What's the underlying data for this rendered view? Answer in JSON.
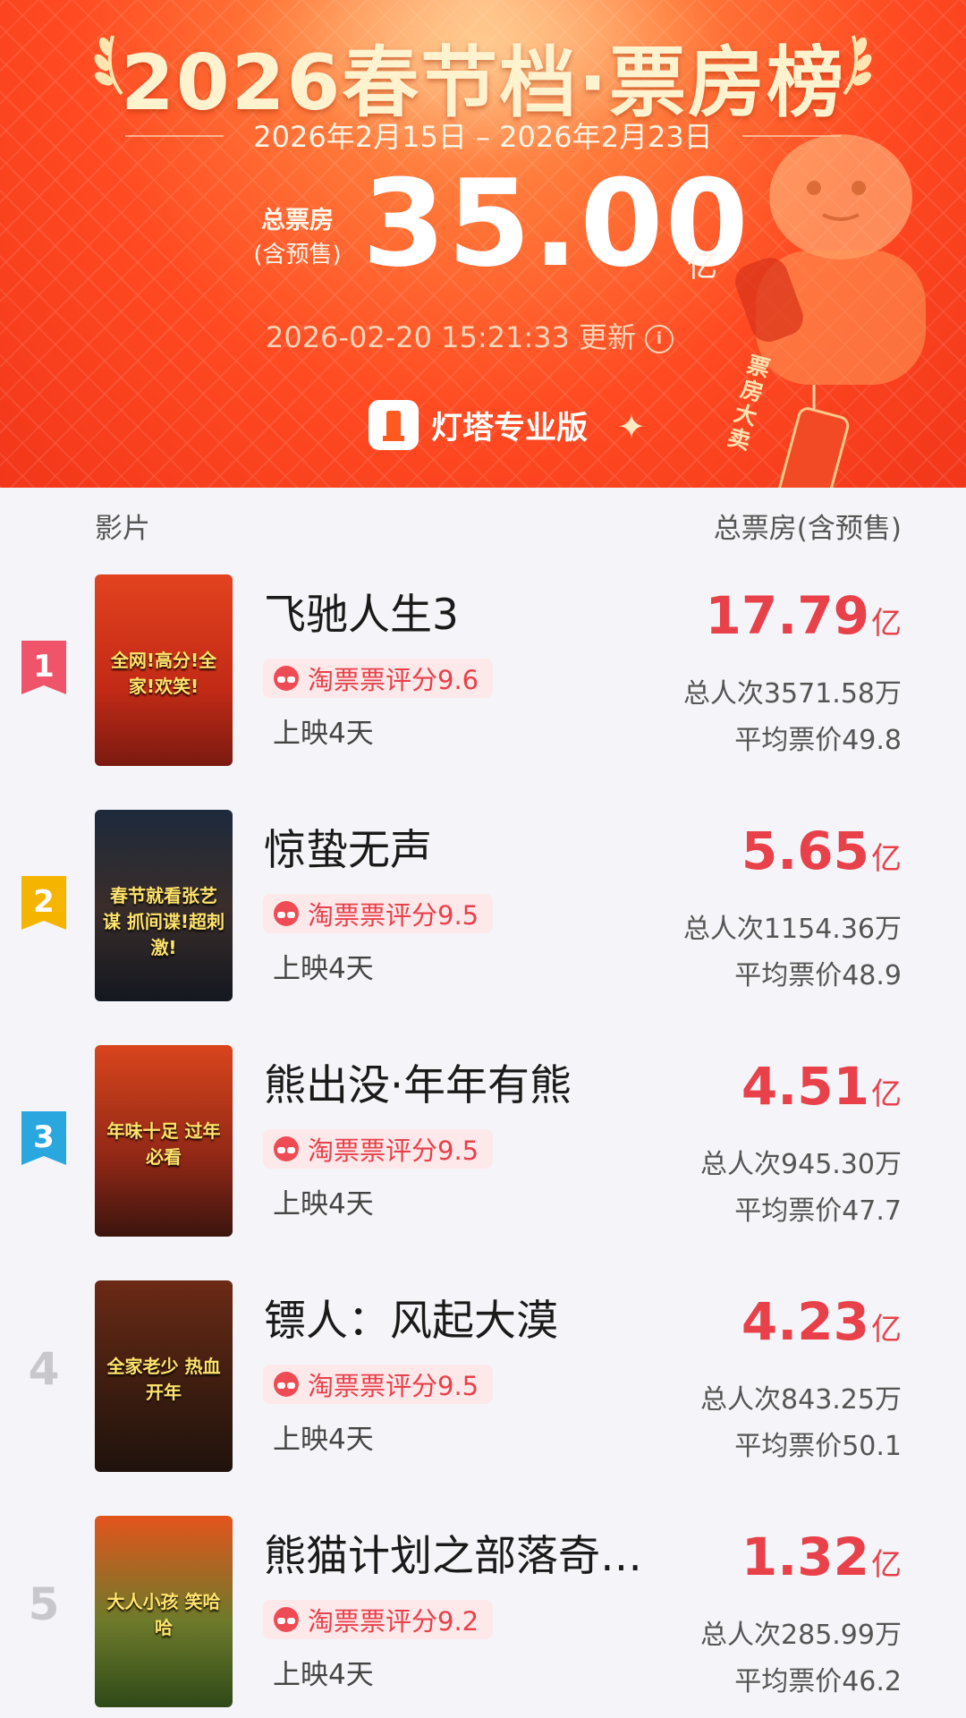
{
  "banner": {
    "title": "2026春节档·票房榜",
    "date_range": "2026年2月15日 – 2026年2月23日",
    "total_label_1": "总票房",
    "total_label_2": "(含预售)",
    "total_value": "35.00",
    "total_unit": "亿",
    "update_time": "2026-02-20 15:21:33 更新",
    "brand_name": "灯塔专业版",
    "lantern_text": "票房大卖"
  },
  "table_header": {
    "film_col": "影片",
    "gross_col": "总票房(含预售)"
  },
  "films": [
    {
      "rank": "1",
      "name": "飞驰人生3",
      "rating": "淘票票评分9.6",
      "days": "上映4天",
      "gross": "17.79",
      "gross_unit": "亿",
      "viewers": "总人次3571.58万",
      "avg_price": "平均票价49.8",
      "poster_text": "全网!高分!全家!欢笑!"
    },
    {
      "rank": "2",
      "name": "惊蛰无声",
      "rating": "淘票票评分9.5",
      "days": "上映4天",
      "gross": "5.65",
      "gross_unit": "亿",
      "viewers": "总人次1154.36万",
      "avg_price": "平均票价48.9",
      "poster_text": "春节就看张艺谋 抓间谍!超刺激!"
    },
    {
      "rank": "3",
      "name": "熊出没·年年有熊",
      "rating": "淘票票评分9.5",
      "days": "上映4天",
      "gross": "4.51",
      "gross_unit": "亿",
      "viewers": "总人次945.30万",
      "avg_price": "平均票价47.7",
      "poster_text": "年味十足 过年必看"
    },
    {
      "rank": "4",
      "name": "镖人：风起大漠",
      "rating": "淘票票评分9.5",
      "days": "上映4天",
      "gross": "4.23",
      "gross_unit": "亿",
      "viewers": "总人次843.25万",
      "avg_price": "平均票价50.1",
      "poster_text": "全家老少 热血开年"
    },
    {
      "rank": "5",
      "name": "熊猫计划之部落奇…",
      "rating": "淘票票评分9.2",
      "days": "上映4天",
      "gross": "1.32",
      "gross_unit": "亿",
      "viewers": "总人次285.99万",
      "avg_price": "平均票价46.2",
      "poster_text": "大人小孩 笑哈哈"
    }
  ],
  "colors": {
    "accent_red": "#e8414a",
    "rank1": "#f0546a",
    "rank2": "#f5b400",
    "rank3": "#2ba7e0"
  }
}
